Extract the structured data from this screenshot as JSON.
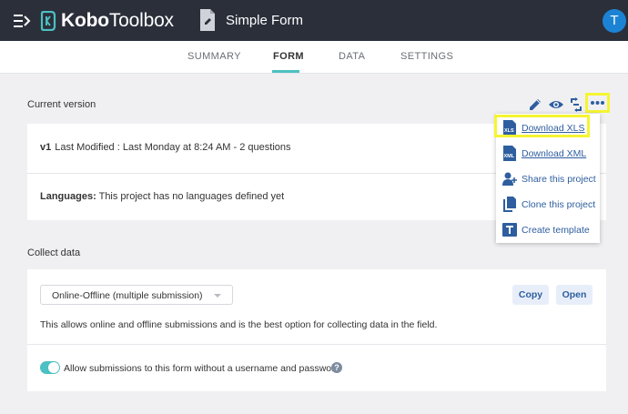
{
  "header": {
    "logo_prefix": "Kobo",
    "logo_suffix": "Toolbox",
    "form_title": "Simple Form",
    "avatar_initial": "T"
  },
  "tabs": [
    {
      "label": "SUMMARY"
    },
    {
      "label": "FORM"
    },
    {
      "label": "DATA"
    },
    {
      "label": "SETTINGS"
    }
  ],
  "current_version": {
    "heading": "Current version",
    "version_label": "v1",
    "modified_text": "Last Modified : Last Monday at 8:24 AM - 2 questions",
    "languages_label": "Languages:",
    "languages_text": "This project has no languages defined yet"
  },
  "more_menu": [
    {
      "label": "Download XLS",
      "icon": "xls-file-icon"
    },
    {
      "label": "Download XML",
      "icon": "xml-file-icon"
    },
    {
      "label": "Share this project",
      "icon": "add-user-icon"
    },
    {
      "label": "Clone this project",
      "icon": "clone-icon"
    },
    {
      "label": "Create template",
      "icon": "template-icon"
    }
  ],
  "collect_data": {
    "heading": "Collect data",
    "mode_selected": "Online-Offline (multiple submission)",
    "copy_label": "Copy",
    "open_label": "Open",
    "description": "This allows online and offline submissions and is the best option for collecting data in the field.",
    "anonymous_label": "Allow submissions to this form without a username and password",
    "anonymous_enabled": true
  },
  "colors": {
    "topbar": "#2b2f3a",
    "accent": "#4cc0c2",
    "link": "#2e5e9f",
    "avatar": "#1c83d4",
    "highlight": "#f5f532"
  }
}
